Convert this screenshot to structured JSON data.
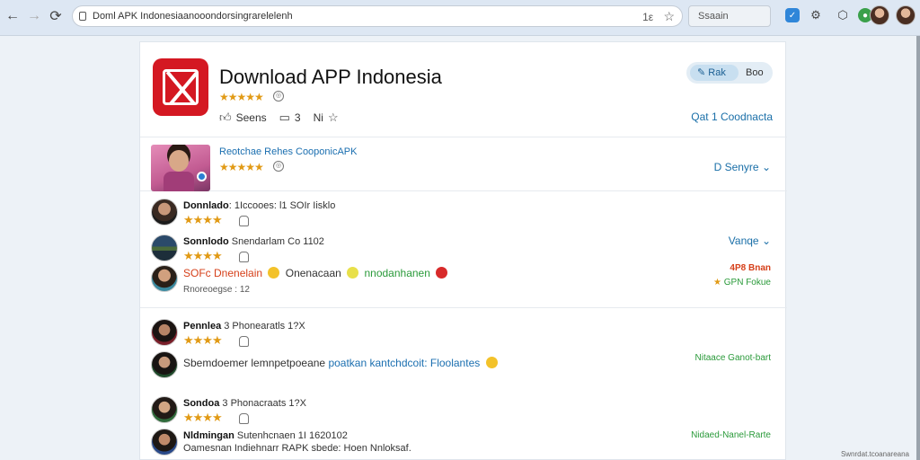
{
  "browser": {
    "url": "Doml APK Indonesiaanooondorsingrarelelenh",
    "url_tool": "1ε",
    "search_placeholder": "Ssaain"
  },
  "app": {
    "title": "Download APP Indonesia",
    "stars": "★★★★★",
    "rating_glyph": "◎",
    "actions": [
      {
        "icon": "thumbs-up-icon",
        "label": "Seens"
      },
      {
        "icon": "comment-icon",
        "label": "3"
      },
      {
        "icon": "star-icon",
        "label": "Ni"
      }
    ],
    "pill_primary": "Rak",
    "pill_secondary": "Boo",
    "header_link": "Qat 1 Coodnacta"
  },
  "featured": {
    "title": "Reotchae Rehes CooponicAPK",
    "stars": "★★★★★",
    "rating_glyph": "◎",
    "dropdown": "D Senyre"
  },
  "reviews_group1": {
    "dropdown": "Vanqe",
    "items": [
      {
        "name": "Donnlado",
        "meta": ": 1Iccooes: l1 SOIr Iisklo",
        "stars": "★★★★"
      },
      {
        "name": "Sonnlodo",
        "meta": "Snendarlam Co 1102",
        "stars": "★★★★"
      }
    ],
    "comment": {
      "part1": "SOFc Dnenelain",
      "part2": "Onenacaan",
      "part3": "nnodanhanen",
      "meta": "Rnoreoegse : 12"
    },
    "side_red": "4P8 Bnan",
    "side_green": "GPN Fokue",
    "colors": {
      "red": "#d6401a",
      "green": "#2a9a3a"
    }
  },
  "reviews_group2": {
    "items": [
      {
        "name": "Pennlea",
        "meta": "3 Phonearatls 1?X",
        "stars": "★★★★"
      },
      {
        "name": "Sondoa",
        "meta": "3 Phonacraats 1?X",
        "stars": "★★★★"
      },
      {
        "name": "Nldmingan",
        "meta": "Sutenhcnaen 1I 1620102",
        "stars": ""
      }
    ],
    "comment1": {
      "part1": "Sbemdoemer lemnpetpoeane",
      "part2": "poatkan kantchdcoit:",
      "part3": "Floolantes"
    },
    "comment2": "Oamesnan Indiehnarr RAPK sbede: Hoen Nnloksaf.",
    "side_tag1": "Nitaace Ganot-bart",
    "side_tag2": "Nidaed-Nanel-Rarte"
  },
  "watermark": "Swnrdat.tcoanareana"
}
